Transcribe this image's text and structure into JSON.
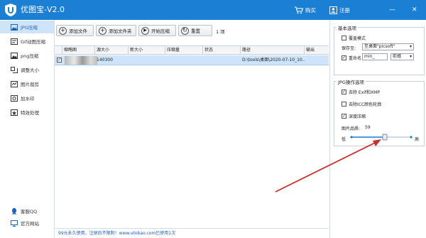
{
  "app": {
    "title": "优图宝-V2.0"
  },
  "titlebar": {
    "buy_label": "购买",
    "register_label": "注册",
    "minimize_glyph": "—",
    "close_glyph": "✕"
  },
  "sidebar": {
    "items": [
      {
        "label": "JPG压缩",
        "icon": "image-icon",
        "active": true
      },
      {
        "label": "Gif动图压缩",
        "icon": "gif-icon"
      },
      {
        "label": "png压缩",
        "icon": "image-icon"
      },
      {
        "label": "调整大小",
        "icon": "resize-icon"
      },
      {
        "label": "图片裁剪",
        "icon": "crop-icon"
      },
      {
        "label": "加水印",
        "icon": "watermark-icon"
      },
      {
        "label": "特效处理",
        "icon": "effects-icon"
      }
    ],
    "bottom": [
      {
        "label": "客服QQ",
        "icon": "support-icon"
      },
      {
        "label": "官方网站",
        "icon": "website-icon"
      }
    ]
  },
  "toolbar": {
    "add_file": "添加文件",
    "add_folder": "添加文件夹",
    "start": "开始压缩",
    "reset": "重置",
    "count": "1 项"
  },
  "table": {
    "columns": [
      "缩略图",
      "源大小",
      "新大小",
      "压缩量",
      "状态",
      "路径",
      "输出"
    ],
    "rows": [
      {
        "checked": true,
        "source_size": "140300",
        "new_size": "",
        "ratio": "",
        "status": "",
        "path": "D:\\tools\\桌面\\2020-07-10_10...",
        "output": ""
      }
    ]
  },
  "footer": {
    "text": "99元永久使用，注册后不限制！www.utobao.com已使用1次"
  },
  "panel": {
    "basic": {
      "title": "基本选项",
      "overwrite_label": "覆盖模式",
      "overwrite_checked": false,
      "save_to_label": "保存至:",
      "save_to_value": "至桌面\"picsoft\"",
      "rename_label": "重命名",
      "rename_checked": true,
      "rename_value": "min_",
      "rename_position": "前缀"
    },
    "jpg": {
      "title": "JPG操作选项",
      "remove_exif": "去除 Exif和XMP",
      "remove_exif_checked": true,
      "remove_icc": "去除ICC颜色轮廓",
      "remove_icc_checked": false,
      "deep_compress": "深度压缩",
      "deep_compress_checked": true,
      "quality_label": "图片品质:",
      "quality_value": "59",
      "low_label": "低",
      "high_label": "高"
    }
  },
  "colors": {
    "brand": "#1b7fd3",
    "selected_row": "#cde4fa",
    "arrow": "#c8312b"
  }
}
